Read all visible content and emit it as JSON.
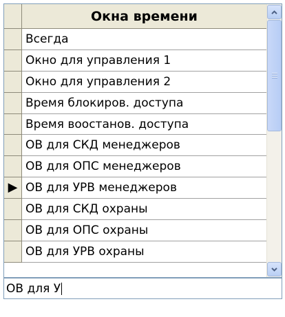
{
  "grid": {
    "column_header": "Окна времени",
    "current_row_marker": "▶",
    "rows": [
      "Всегда",
      "Окно для управления 1",
      "Окно для управления 2",
      "Время блокиров. доступа",
      "Время воостанов. доступа",
      "ОВ для СКД менеджеров",
      "ОВ для ОПС менеджеров",
      "ОВ для УРВ менеджеров",
      "ОВ для СКД охраны",
      "ОВ для ОПС охраны",
      "ОВ для УРВ охраны"
    ]
  },
  "search": {
    "value": "ОВ для У"
  },
  "icons": {
    "scroll_up": "chevron-up-icon",
    "scroll_down": "chevron-down-icon",
    "current_row": "current-row-arrow-icon"
  },
  "colors": {
    "header_bg": "#ece9d8",
    "scroll_accent": "#b9cff4",
    "border": "#7f9db9"
  }
}
